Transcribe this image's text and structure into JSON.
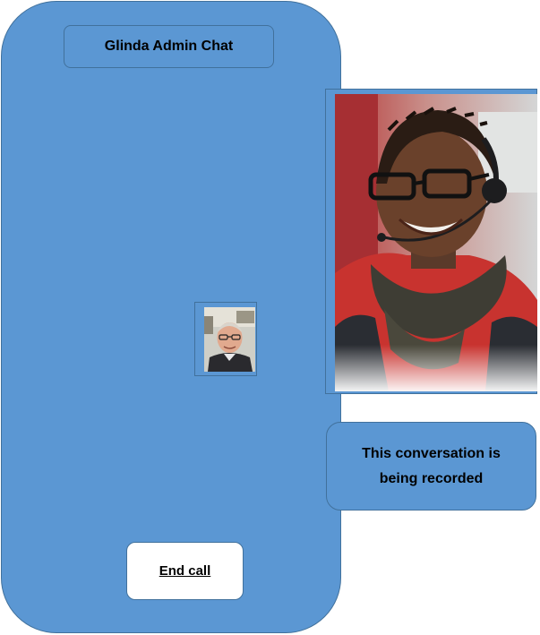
{
  "app": {
    "title": "Glinda Admin Chat"
  },
  "call": {
    "end_call_label": "End call",
    "recording_notice": "This conversation is being recorded"
  },
  "video": {
    "self_view_icon": "user-avatar-photo",
    "remote_view_icon": "agent-avatar-photo"
  },
  "colors": {
    "panel_blue": "#5b97d3",
    "border_blue": "#41719c",
    "button_white": "#ffffff"
  }
}
